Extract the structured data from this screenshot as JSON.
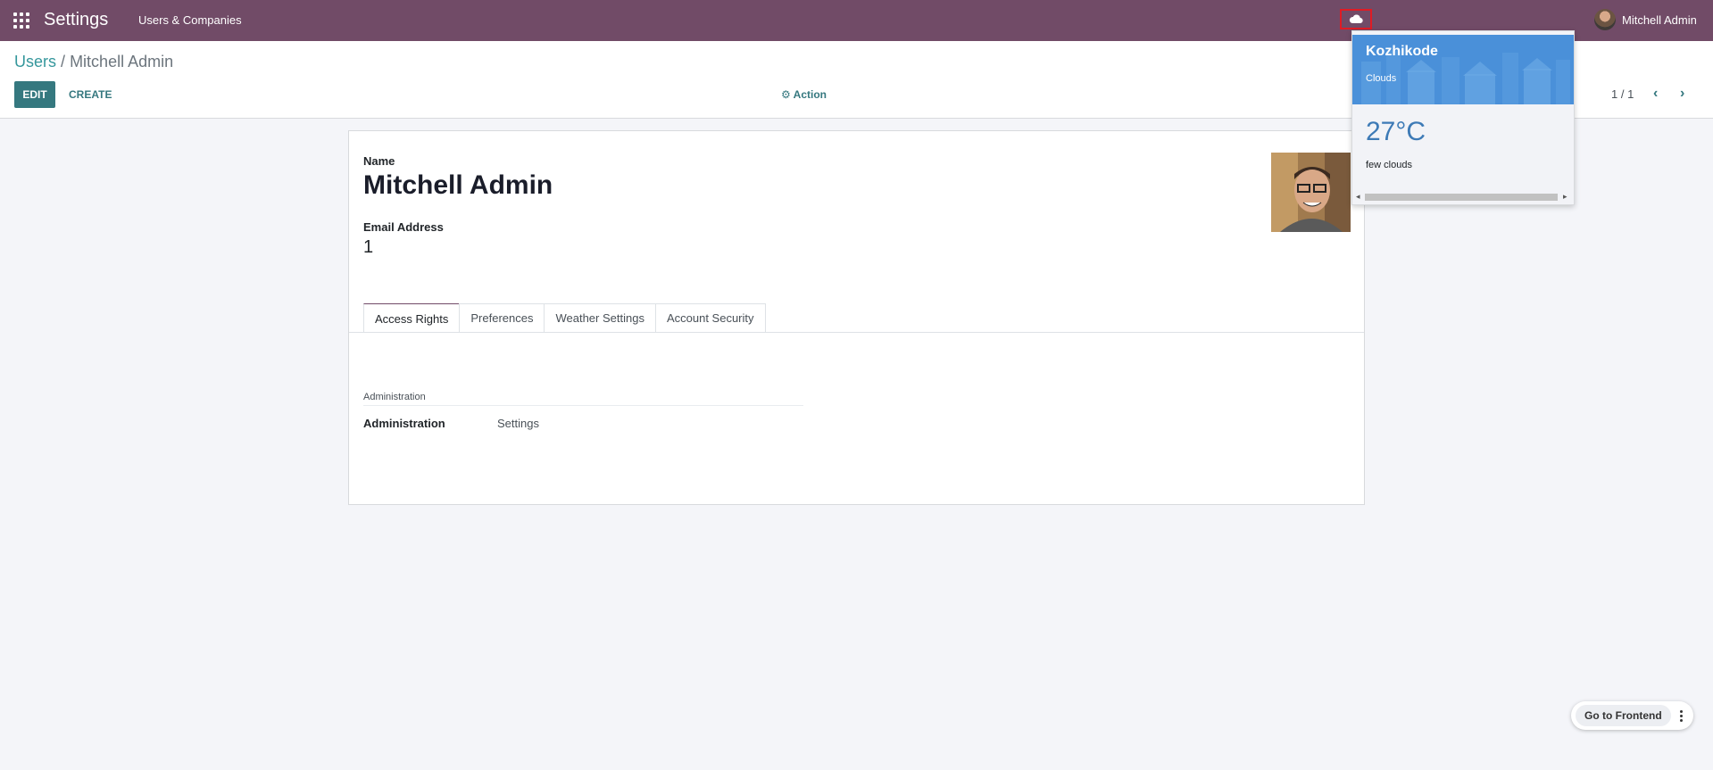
{
  "navbar": {
    "app_title": "Settings",
    "menu_users_companies": "Users & Companies",
    "weather_icon": "cloud-icon",
    "user_name": "Mitchell Admin"
  },
  "breadcrumb": {
    "parent": "Users",
    "separator": "/",
    "current": "Mitchell Admin"
  },
  "toolbar": {
    "edit_label": "EDIT",
    "create_label": "CREATE",
    "action_label": "Action",
    "pager": "1 / 1"
  },
  "form": {
    "name_label": "Name",
    "name_value": "Mitchell Admin",
    "email_label": "Email Address",
    "email_value": "1",
    "tabs": [
      {
        "label": "Access Rights",
        "active": true
      },
      {
        "label": "Preferences",
        "active": false
      },
      {
        "label": "Weather Settings",
        "active": false
      },
      {
        "label": "Account Security",
        "active": false
      }
    ],
    "section_title": "Administration",
    "field_label": "Administration",
    "field_value": "Settings"
  },
  "weather": {
    "city": "Kozhikode",
    "condition": "Clouds",
    "temperature": "27°C",
    "description": "few clouds"
  },
  "frontend": {
    "button_label": "Go to Frontend"
  },
  "colors": {
    "navbar": "#714b67",
    "primary_button": "#35787f",
    "weather_banner": "#4a90d9",
    "temperature": "#3d7ab6",
    "highlight_border": "#e01b24"
  }
}
